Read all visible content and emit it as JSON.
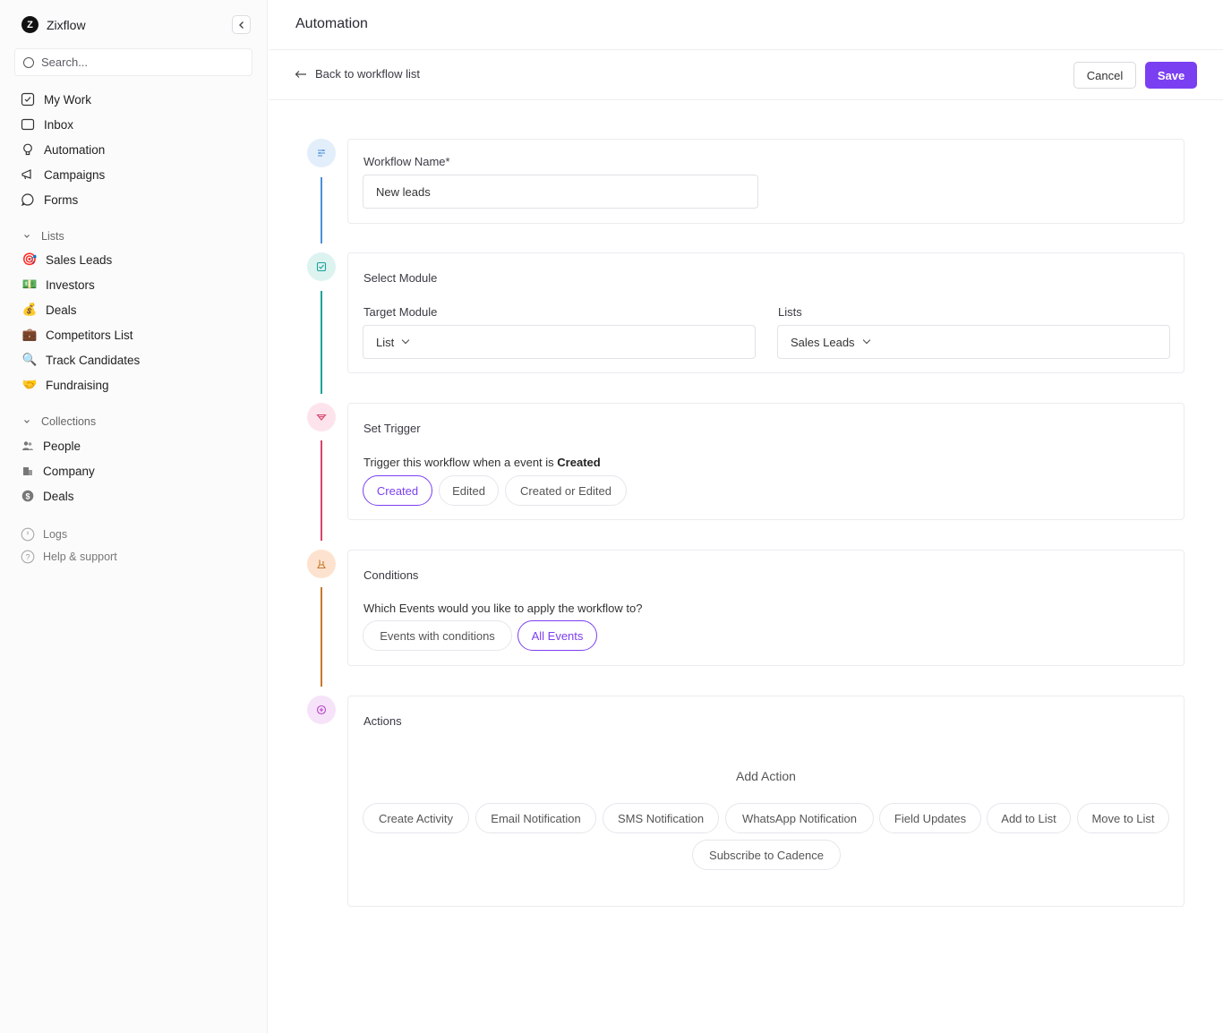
{
  "sidebar": {
    "brand": {
      "logo_letter": "Z",
      "name": "Zixflow"
    },
    "search_placeholder": "Search...",
    "main_items": [
      {
        "label": "My Work",
        "icon": "checkbox-icon"
      },
      {
        "label": "Inbox",
        "icon": "inbox-icon"
      },
      {
        "label": "Automation",
        "icon": "bulb-icon"
      },
      {
        "label": "Campaigns",
        "icon": "megaphone-icon"
      },
      {
        "label": "Forms",
        "icon": "chat-icon"
      }
    ],
    "lists_heading": "Lists",
    "lists": [
      {
        "label": "Sales Leads",
        "icon": "target-emoji"
      },
      {
        "label": "Investors",
        "icon": "money-emoji"
      },
      {
        "label": "Deals",
        "icon": "moneybag-emoji"
      },
      {
        "label": "Competitors List",
        "icon": "briefcase-emoji"
      },
      {
        "label": "Track Candidates",
        "icon": "magnifier-emoji"
      },
      {
        "label": "Fundraising",
        "icon": "handshake-emoji"
      }
    ],
    "collections_heading": "Collections",
    "collections": [
      {
        "label": "People",
        "icon": "people-icon"
      },
      {
        "label": "Company",
        "icon": "building-icon"
      },
      {
        "label": "Deals",
        "icon": "dollar-icon"
      }
    ],
    "footer": [
      {
        "label": "Logs",
        "icon": "clock-icon"
      },
      {
        "label": "Help & support",
        "icon": "help-icon"
      }
    ]
  },
  "header": {
    "title": "Automation"
  },
  "toolbar": {
    "back_label": "Back to workflow list",
    "cancel_label": "Cancel",
    "save_label": "Save"
  },
  "workflow": {
    "name_label": "Workflow Name*",
    "name_value": "New leads"
  },
  "module": {
    "heading": "Select Module",
    "target_label": "Target Module",
    "target_value": "List",
    "lists_label": "Lists",
    "lists_value": "Sales Leads"
  },
  "trigger": {
    "heading": "Set Trigger",
    "sentence": "Trigger this workflow when a event is",
    "sentence_value": "Created",
    "options": [
      "Created",
      "Edited",
      "Created or Edited"
    ],
    "selected": "Created"
  },
  "conditions": {
    "heading": "Conditions",
    "question": "Which Events would you like to apply the workflow to?",
    "options": [
      "Events with conditions",
      "All Events"
    ],
    "selected": "All Events"
  },
  "actions": {
    "heading": "Actions",
    "add_label": "Add Action",
    "options": [
      "Create Activity",
      "Email Notification",
      "SMS Notification",
      "WhatsApp Notification",
      "Field Updates",
      "Add to List",
      "Move to List",
      "Subscribe to Cadence"
    ]
  },
  "colors": {
    "accent": "#7b3ff2",
    "step_workflow": "#4a90d9",
    "step_module": "#1aa39a",
    "step_trigger": "#d9436b",
    "step_conditions": "#c7782a",
    "step_actions": "#b845c9"
  }
}
